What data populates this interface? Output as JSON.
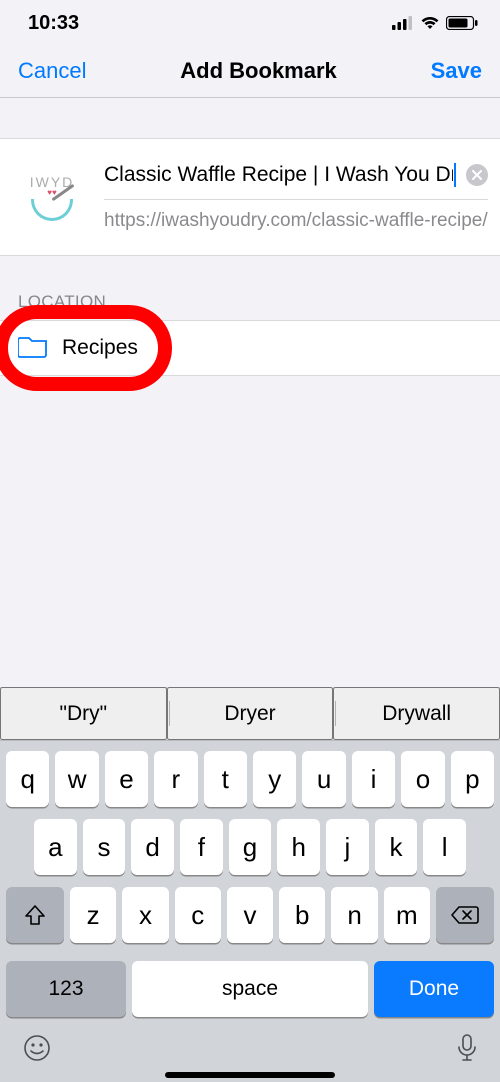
{
  "status": {
    "time": "10:33"
  },
  "nav": {
    "cancel": "Cancel",
    "title": "Add Bookmark",
    "save": "Save"
  },
  "bookmark": {
    "favicon_text": "IWYD",
    "title": "Classic Waffle Recipe | I Wash You Dry",
    "url": "https://iwashyoudry.com/classic-waffle-recipe/"
  },
  "location": {
    "section_label": "LOCATION",
    "folder": "Recipes"
  },
  "suggestions": [
    "\"Dry\"",
    "Dryer",
    "Drywall"
  ],
  "keyboard": {
    "row1": [
      "q",
      "w",
      "e",
      "r",
      "t",
      "y",
      "u",
      "i",
      "o",
      "p"
    ],
    "row2": [
      "a",
      "s",
      "d",
      "f",
      "g",
      "h",
      "j",
      "k",
      "l"
    ],
    "row3": [
      "z",
      "x",
      "c",
      "v",
      "b",
      "n",
      "m"
    ],
    "numkey": "123",
    "space": "space",
    "done": "Done"
  }
}
